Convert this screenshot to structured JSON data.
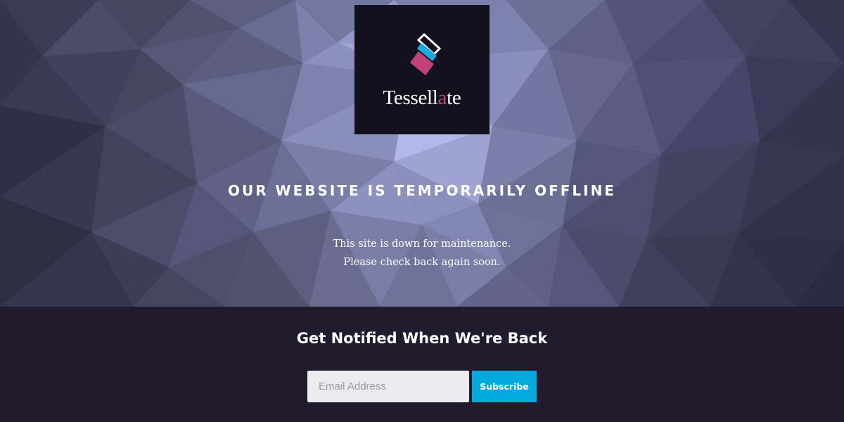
{
  "brand": {
    "name_part1": "Tessell",
    "name_accent": "a",
    "name_part2": "te",
    "accent_color": "#c2417a",
    "mark_colors": [
      "#ffffff",
      "#1fa8dc",
      "#c2417a"
    ],
    "logo_icon": "stacked-diamonds-logo"
  },
  "hero": {
    "headline": "OUR WEBSITE IS TEMPORARILY OFFLINE",
    "message_line1": "This site is down for maintenance.",
    "message_line2": "Please check back again soon.",
    "background": "low-poly tessellated triangles, slate blue-purple"
  },
  "notify": {
    "title": "Get Notified When We're Back",
    "email_placeholder": "Email Address",
    "email_value": "",
    "subscribe_label": "Subscribe",
    "button_color": "#03a9dc",
    "section_bg": "#201b2d"
  }
}
